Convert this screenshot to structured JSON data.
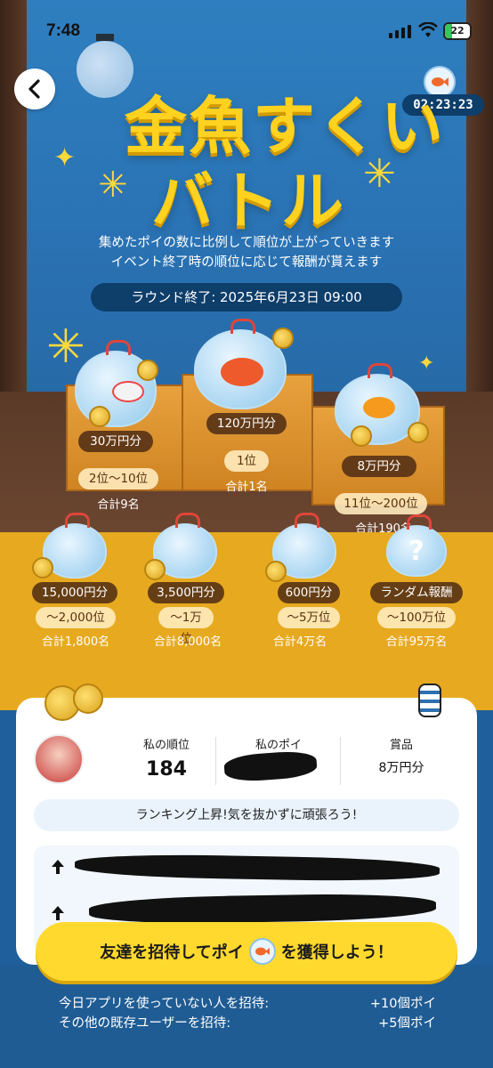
{
  "status": {
    "time": "7:48",
    "battery": "22"
  },
  "timer": "02:23:23",
  "title": {
    "line1": "金魚すくい",
    "line2": "バトル"
  },
  "description": [
    "集めたポイの数に比例して順位が上がっていきます",
    "イベント終了時の順位に応じて報酬が貰えます"
  ],
  "round_end": "ラウンド終了: 2025年6月23日 09:00",
  "podium": {
    "first": {
      "prize": "120万円分",
      "rank": "1位",
      "count": "合計1名"
    },
    "second": {
      "prize": "30万円分",
      "rank": "2位〜10位",
      "count": "合計9名"
    },
    "third": {
      "prize": "8万円分",
      "rank": "11位〜200位",
      "count": "合計190名"
    }
  },
  "tiers": [
    {
      "prize": "15,000円分",
      "rank": "〜2,000位",
      "count": "合計1,800名"
    },
    {
      "prize": "3,500円分",
      "rank": "〜1万位",
      "count": "合計8,000名"
    },
    {
      "prize": "600円分",
      "rank": "〜5万位",
      "count": "合計4万名"
    },
    {
      "prize": "ランダム報酬",
      "rank": "〜100万位",
      "count": "合計95万名"
    }
  ],
  "me": {
    "rank_label": "私の順位",
    "rank_value": "184",
    "poi_label": "私のポイ",
    "prize_label": "賞品",
    "prize_value": "8万円分"
  },
  "encourage": "ランキング上昇!気を抜かずに頑張ろう!",
  "invite": {
    "left": "友達を招待してポイ",
    "right": "を獲得しよう！"
  },
  "rewards": [
    {
      "label": "今日アプリを使っていない人を招待:",
      "value": "+10個ポイ"
    },
    {
      "label": "その他の既存ユーザーを招待:",
      "value": "+5個ポイ"
    }
  ],
  "colors": {
    "title": "#ffd21f",
    "bg_blue": "#2e7fbf",
    "gold": "#e7a91f",
    "invite": "#ffd92e"
  },
  "icons": [
    "back-icon",
    "goldfish-icon",
    "lantern-icon",
    "coin-icon",
    "arrow-up-icon"
  ]
}
